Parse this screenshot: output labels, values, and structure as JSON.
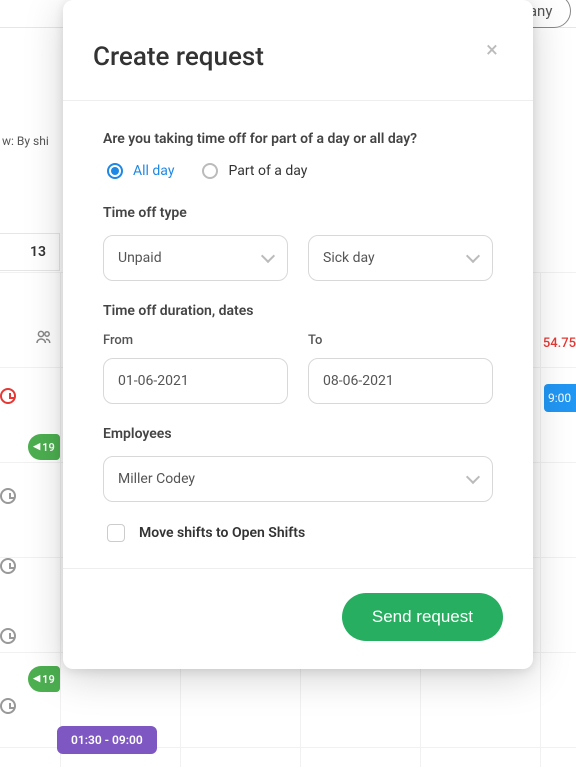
{
  "background": {
    "company_label": "Company",
    "view_label": "w: By shi",
    "day_number": "13",
    "red_time": "54.75",
    "blue_time": "9:00",
    "green_tab_a": "19",
    "green_tab_b": "19",
    "purple_shift": "01:30 - 09:00"
  },
  "modal": {
    "title": "Create request",
    "question": "Are you taking time off for part of a day or all day?",
    "radio_all_day": "All day",
    "radio_part": "Part of a day",
    "type_label": "Time off type",
    "type_value_a": "Unpaid",
    "type_value_b": "Sick day",
    "duration_label": "Time off duration, dates",
    "from_label": "From",
    "to_label": "To",
    "from_value": "01-06-2021",
    "to_value": "08-06-2021",
    "employees_label": "Employees",
    "employees_value": "Miller Codey",
    "move_shifts_label": "Move shifts to Open Shifts",
    "send_button": "Send request"
  }
}
